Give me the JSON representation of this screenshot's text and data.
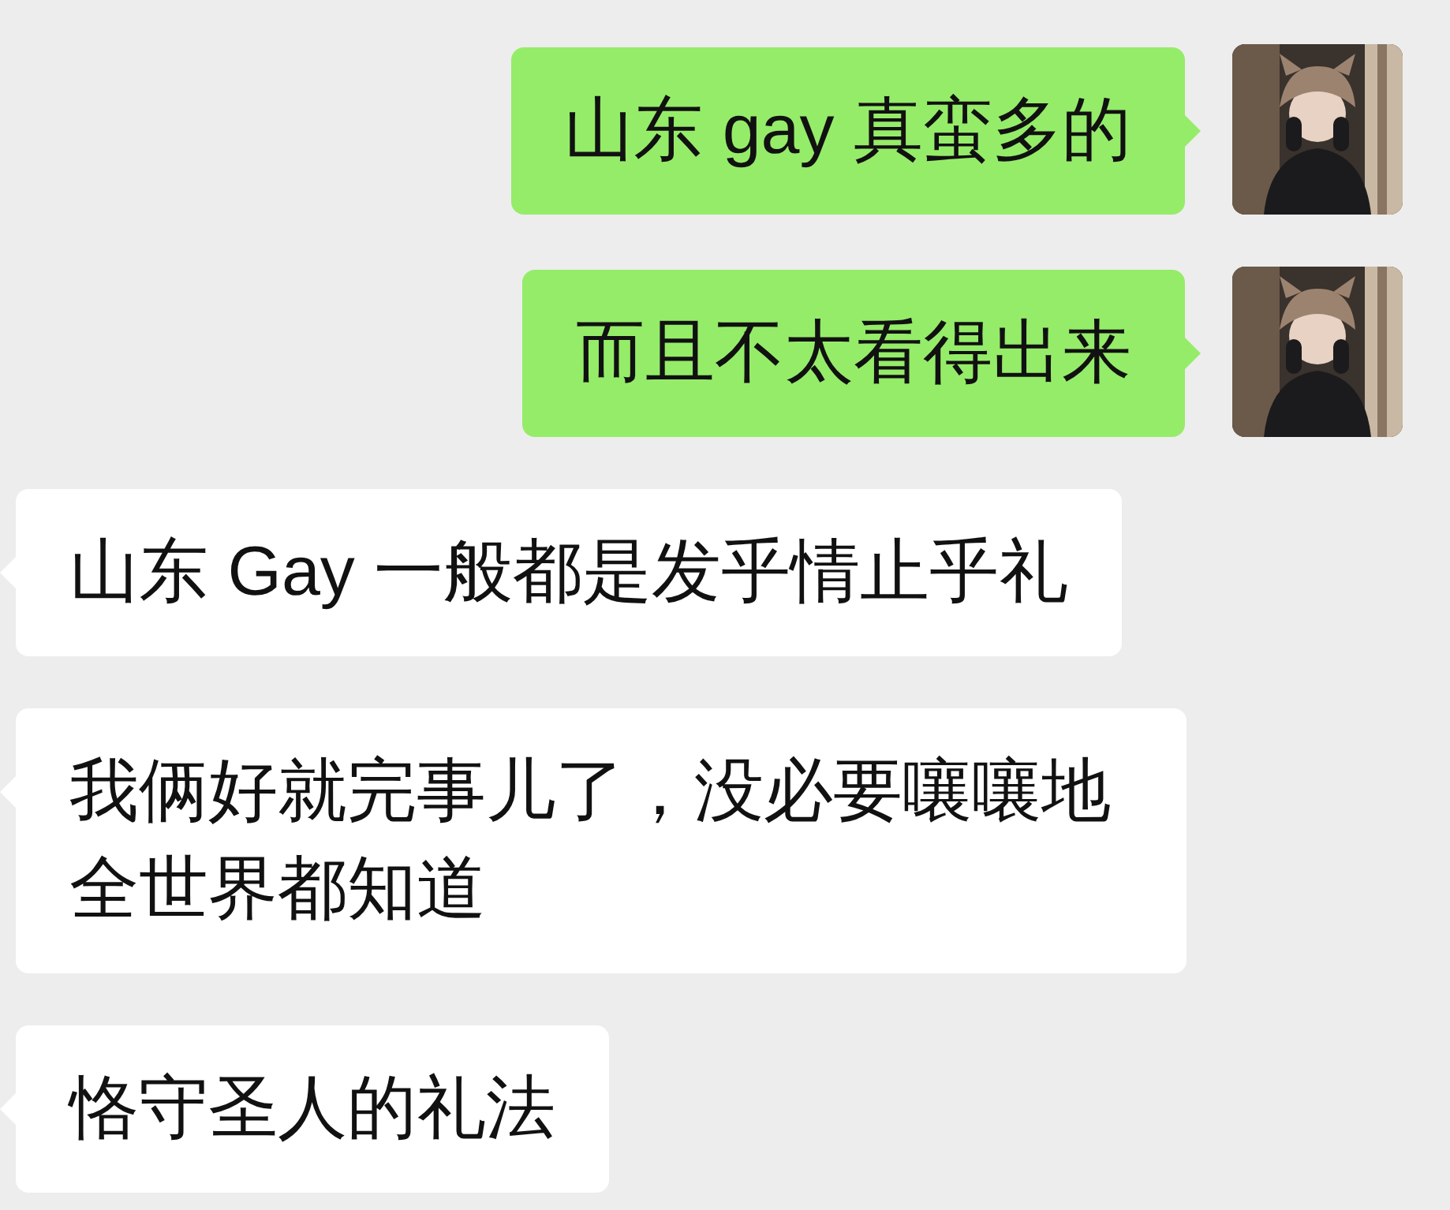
{
  "messages": [
    {
      "kind": "outgoing",
      "text": "山东 gay 真蛮多的"
    },
    {
      "kind": "outgoing",
      "text": "而且不太看得出来"
    },
    {
      "kind": "incoming",
      "text": "山东 Gay 一般都是发乎情止乎礼"
    },
    {
      "kind": "incoming",
      "text": "我俩好就完事儿了，没必要嚷嚷地全世界都知道"
    },
    {
      "kind": "incoming",
      "text": "恪守圣人的礼法"
    }
  ]
}
